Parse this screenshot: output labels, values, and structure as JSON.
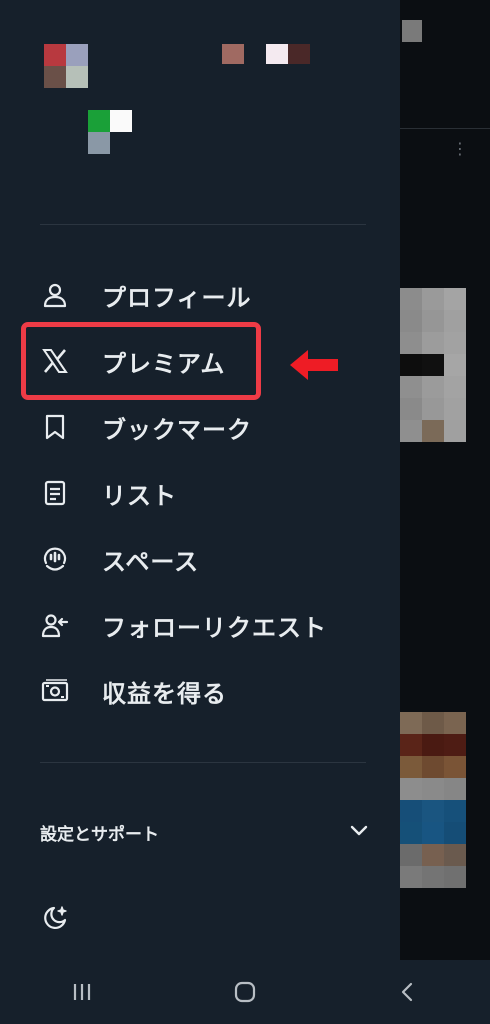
{
  "drawer": {
    "menu": [
      {
        "label": "プロフィール",
        "icon": "person-icon"
      },
      {
        "label": "プレミアム",
        "icon": "x-logo-icon"
      },
      {
        "label": "ブックマーク",
        "icon": "bookmark-icon"
      },
      {
        "label": "リスト",
        "icon": "list-icon"
      },
      {
        "label": "スペース",
        "icon": "spaces-icon"
      },
      {
        "label": "フォローリクエスト",
        "icon": "follow-request-icon"
      },
      {
        "label": "収益を得る",
        "icon": "monetization-icon"
      }
    ],
    "settings_label": "設定とサポート"
  },
  "annotation": {
    "color": "#ee3b46"
  },
  "colors": {
    "drawer_bg": "#16202b",
    "text": "#e8ecef",
    "divider": "#2b3540"
  }
}
